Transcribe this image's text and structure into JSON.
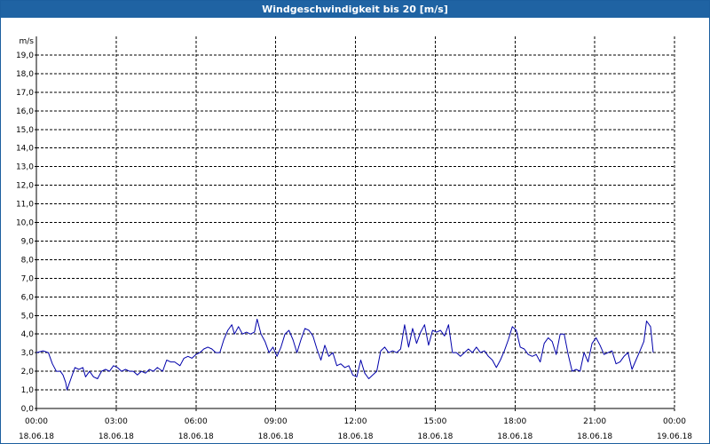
{
  "window": {
    "title": "Windgeschwindigkeit bis 20 [m/s]"
  },
  "colors": {
    "titlebar": "#1f63a3",
    "series": "#0000aa",
    "grid": "#000000"
  },
  "chart_data": {
    "type": "line",
    "title": "Windgeschwindigkeit bis 20 [m/s]",
    "ylabel": "m/s",
    "ylim": [
      0,
      20
    ],
    "yticks": [
      "0,0",
      "1,0",
      "2,0",
      "3,0",
      "4,0",
      "5,0",
      "6,0",
      "7,0",
      "8,0",
      "9,0",
      "10,0",
      "11,0",
      "12,0",
      "13,0",
      "14,0",
      "15,0",
      "16,0",
      "17,0",
      "18,0",
      "19,0"
    ],
    "xlim_hours": [
      0,
      24
    ],
    "xticks": [
      {
        "h": 0,
        "time": "00:00",
        "date": "18.06.18"
      },
      {
        "h": 3,
        "time": "03:00",
        "date": "18.06.18"
      },
      {
        "h": 6,
        "time": "06:00",
        "date": "18.06.18"
      },
      {
        "h": 9,
        "time": "09:00",
        "date": "18.06.18"
      },
      {
        "h": 12,
        "time": "12:00",
        "date": "18.06.18"
      },
      {
        "h": 15,
        "time": "15:00",
        "date": "18.06.18"
      },
      {
        "h": 18,
        "time": "18:00",
        "date": "18.06.18"
      },
      {
        "h": 21,
        "time": "21:00",
        "date": "18.06.18"
      },
      {
        "h": 24,
        "time": "00:00",
        "date": "19.06.18"
      }
    ],
    "grid": true,
    "series": [
      {
        "values": [
          [
            0.0,
            3.0
          ],
          [
            0.25,
            3.1
          ],
          [
            0.45,
            3.0
          ],
          [
            0.6,
            2.4
          ],
          [
            0.75,
            2.0
          ],
          [
            0.9,
            2.0
          ],
          [
            1.0,
            1.8
          ],
          [
            1.1,
            1.4
          ],
          [
            1.15,
            1.0
          ],
          [
            1.3,
            1.6
          ],
          [
            1.45,
            2.2
          ],
          [
            1.6,
            2.1
          ],
          [
            1.75,
            2.2
          ],
          [
            1.85,
            1.7
          ],
          [
            2.0,
            2.0
          ],
          [
            2.15,
            1.7
          ],
          [
            2.3,
            1.6
          ],
          [
            2.45,
            2.0
          ],
          [
            2.6,
            2.1
          ],
          [
            2.75,
            2.0
          ],
          [
            2.9,
            2.3
          ],
          [
            3.05,
            2.2
          ],
          [
            3.2,
            2.0
          ],
          [
            3.35,
            2.1
          ],
          [
            3.5,
            2.0
          ],
          [
            3.65,
            2.0
          ],
          [
            3.8,
            1.8
          ],
          [
            3.95,
            2.0
          ],
          [
            4.1,
            1.9
          ],
          [
            4.25,
            2.1
          ],
          [
            4.4,
            2.0
          ],
          [
            4.55,
            2.2
          ],
          [
            4.75,
            2.0
          ],
          [
            4.9,
            2.6
          ],
          [
            5.05,
            2.5
          ],
          [
            5.2,
            2.5
          ],
          [
            5.4,
            2.3
          ],
          [
            5.55,
            2.7
          ],
          [
            5.7,
            2.8
          ],
          [
            5.85,
            2.7
          ],
          [
            6.0,
            2.9
          ],
          [
            6.15,
            3.0
          ],
          [
            6.3,
            3.2
          ],
          [
            6.45,
            3.3
          ],
          [
            6.6,
            3.2
          ],
          [
            6.75,
            3.0
          ],
          [
            6.9,
            3.0
          ],
          [
            7.05,
            3.7
          ],
          [
            7.2,
            4.2
          ],
          [
            7.35,
            4.5
          ],
          [
            7.45,
            4.0
          ],
          [
            7.6,
            4.4
          ],
          [
            7.75,
            4.0
          ],
          [
            7.9,
            4.1
          ],
          [
            8.05,
            4.0
          ],
          [
            8.2,
            4.1
          ],
          [
            8.3,
            4.8
          ],
          [
            8.45,
            4.0
          ],
          [
            8.6,
            3.6
          ],
          [
            8.75,
            3.0
          ],
          [
            8.9,
            3.3
          ],
          [
            9.05,
            2.8
          ],
          [
            9.2,
            3.3
          ],
          [
            9.35,
            4.0
          ],
          [
            9.5,
            4.2
          ],
          [
            9.65,
            3.7
          ],
          [
            9.8,
            3.0
          ],
          [
            9.95,
            3.7
          ],
          [
            10.1,
            4.3
          ],
          [
            10.25,
            4.2
          ],
          [
            10.4,
            3.9
          ],
          [
            10.55,
            3.2
          ],
          [
            10.7,
            2.6
          ],
          [
            10.85,
            3.4
          ],
          [
            11.0,
            2.8
          ],
          [
            11.15,
            3.0
          ],
          [
            11.3,
            2.3
          ],
          [
            11.45,
            2.4
          ],
          [
            11.6,
            2.2
          ],
          [
            11.75,
            2.3
          ],
          [
            11.9,
            1.8
          ],
          [
            12.05,
            1.7
          ],
          [
            12.2,
            2.6
          ],
          [
            12.35,
            1.9
          ],
          [
            12.5,
            1.6
          ],
          [
            12.65,
            1.8
          ],
          [
            12.8,
            2.0
          ],
          [
            12.95,
            3.1
          ],
          [
            13.1,
            3.3
          ],
          [
            13.25,
            3.0
          ],
          [
            13.4,
            3.1
          ],
          [
            13.55,
            3.0
          ],
          [
            13.7,
            3.2
          ],
          [
            13.85,
            4.5
          ],
          [
            14.0,
            3.3
          ],
          [
            14.15,
            4.3
          ],
          [
            14.3,
            3.5
          ],
          [
            14.45,
            4.1
          ],
          [
            14.6,
            4.5
          ],
          [
            14.75,
            3.4
          ],
          [
            14.9,
            4.2
          ],
          [
            15.05,
            4.1
          ],
          [
            15.2,
            4.2
          ],
          [
            15.35,
            3.9
          ],
          [
            15.5,
            4.5
          ],
          [
            15.65,
            3.0
          ],
          [
            15.8,
            3.0
          ],
          [
            15.95,
            2.8
          ],
          [
            16.1,
            3.0
          ],
          [
            16.25,
            3.2
          ],
          [
            16.4,
            3.0
          ],
          [
            16.55,
            3.3
          ],
          [
            16.7,
            3.0
          ],
          [
            16.85,
            3.1
          ],
          [
            17.0,
            2.8
          ],
          [
            17.15,
            2.6
          ],
          [
            17.3,
            2.2
          ],
          [
            17.45,
            2.6
          ],
          [
            17.6,
            3.1
          ],
          [
            17.75,
            3.7
          ],
          [
            17.9,
            4.4
          ],
          [
            18.05,
            4.2
          ],
          [
            18.2,
            3.3
          ],
          [
            18.35,
            3.2
          ],
          [
            18.5,
            2.9
          ],
          [
            18.65,
            2.8
          ],
          [
            18.8,
            2.9
          ],
          [
            18.95,
            2.5
          ],
          [
            19.1,
            3.5
          ],
          [
            19.25,
            3.8
          ],
          [
            19.4,
            3.6
          ],
          [
            19.55,
            2.9
          ],
          [
            19.7,
            4.0
          ],
          [
            19.85,
            4.0
          ],
          [
            20.0,
            2.9
          ],
          [
            20.15,
            2.0
          ],
          [
            20.3,
            2.1
          ],
          [
            20.45,
            2.0
          ],
          [
            20.6,
            3.0
          ],
          [
            20.75,
            2.5
          ],
          [
            20.9,
            3.5
          ],
          [
            21.05,
            3.8
          ],
          [
            21.2,
            3.4
          ],
          [
            21.35,
            2.9
          ],
          [
            21.5,
            3.0
          ],
          [
            21.65,
            3.1
          ],
          [
            21.8,
            2.4
          ],
          [
            21.95,
            2.5
          ],
          [
            22.1,
            2.8
          ],
          [
            22.25,
            3.0
          ],
          [
            22.4,
            2.1
          ],
          [
            22.55,
            2.6
          ],
          [
            22.7,
            3.1
          ],
          [
            22.85,
            3.6
          ],
          [
            22.95,
            4.7
          ],
          [
            23.1,
            4.4
          ],
          [
            23.2,
            3.0
          ]
        ]
      }
    ]
  }
}
